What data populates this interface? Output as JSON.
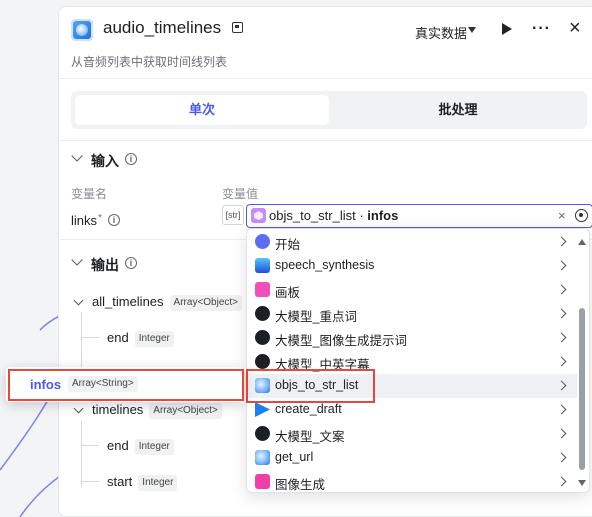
{
  "header": {
    "title": "audio_timelines",
    "subtitle": "从音频列表中获取时间线列表",
    "mode": "真实数据"
  },
  "tabs": [
    {
      "label": "单次",
      "active": true
    },
    {
      "label": "批处理",
      "active": false
    }
  ],
  "input_section": {
    "title": "输入",
    "col_name": "变量名",
    "col_value": "变量值",
    "field": {
      "name": "links",
      "required_mark": "*",
      "type_badge": "[str]",
      "ref_node": "objs_to_str_list",
      "ref_sep": " · ",
      "ref_var": "infos"
    }
  },
  "output_section": {
    "title": "输出",
    "items": [
      {
        "name": "all_timelines",
        "type": "Array<Object>"
      },
      {
        "name": "end",
        "type": "Integer"
      },
      {
        "name": "timelines",
        "type": "Array<Object>"
      },
      {
        "name": "end",
        "type": "Integer"
      },
      {
        "name": "start",
        "type": "Integer"
      }
    ]
  },
  "dropdown": {
    "options": [
      {
        "label": "开始",
        "icon": "start-icon",
        "color": "#5b6cf6"
      },
      {
        "label": "speech_synthesis",
        "icon": "speech-icon",
        "color": "#1f4fd6"
      },
      {
        "label": "画板",
        "icon": "canvas-icon",
        "color": "#f050b8"
      },
      {
        "label": "大模型_重点词",
        "icon": "llm-icon",
        "color": "#1c1f23"
      },
      {
        "label": "大模型_图像生成提示词",
        "icon": "llm-icon",
        "color": "#1c1f23"
      },
      {
        "label": "大模型_中英字幕",
        "icon": "llm-icon",
        "color": "#1c1f23"
      },
      {
        "label": "objs_to_str_list",
        "icon": "plugin-icon",
        "color": "#3d8be8",
        "selected": true
      },
      {
        "label": "create_draft",
        "icon": "draft-icon",
        "color": "#1e7ff0"
      },
      {
        "label": "大模型_文案",
        "icon": "llm-icon",
        "color": "#1c1f23"
      },
      {
        "label": "get_url",
        "icon": "plugin-icon",
        "color": "#3d8be8"
      },
      {
        "label": "图像生成",
        "icon": "image-gen-icon",
        "color": "#f040a8"
      }
    ]
  },
  "popover": {
    "name": "infos",
    "type": "Array<String>"
  },
  "colors": {
    "accent": "#4a5af0",
    "highlight": "#e5483c"
  }
}
